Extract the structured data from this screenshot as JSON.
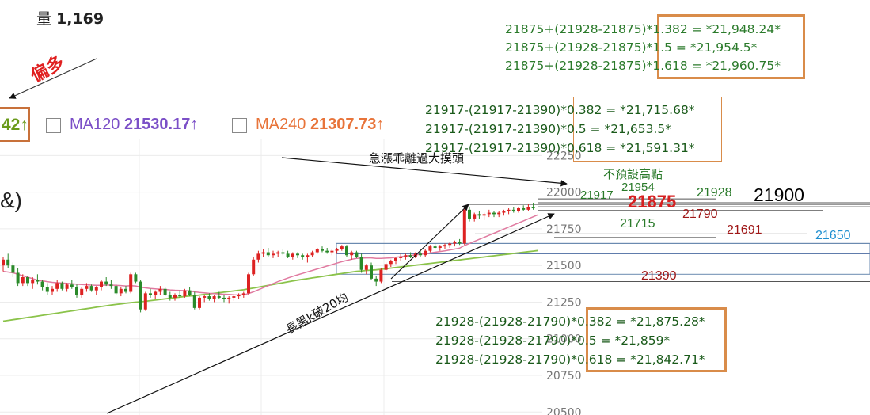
{
  "volume": {
    "label": "量",
    "value": "1,169"
  },
  "annotation_bias": "偏多",
  "ma_header": {
    "partial_value": "42",
    "partial_arrow": "↑",
    "ma120": {
      "label": "MA120",
      "value": "21530.17",
      "arrow": "↑",
      "color": "#7b4fc7"
    },
    "ma240": {
      "label": "MA240",
      "value": "21307.73",
      "arrow": "↑",
      "color": "#e8743a"
    }
  },
  "fib_extension": {
    "color": "#2a7a2a",
    "lines": [
      "21875+(21928-21875)*1.382 = *21,948.24*",
      "21875+(21928-21875)*1.5 = *21,954.5*",
      "21875+(21928-21875)*1.618 = *21,960.75*"
    ]
  },
  "fib_retrace_high": {
    "color": "#1a5a1a",
    "lines": [
      "21917-(21917-21390)*0.382 = *21,715.68*",
      "21917-(21917-21390)*0.5 = *21,653.5*",
      "21917-(21917-21390)*0.618 = *21,591.31*"
    ]
  },
  "fib_retrace_low": {
    "color": "#1a5a1a",
    "lines": [
      "21928-(21928-21790)*0.382 = *21,875.28*",
      "21928-(21928-21790)*0.5 = *21,859*",
      "21928-(21928-21790)*0.618 = *21,842.71*"
    ]
  },
  "annotations": {
    "overheat": "急漲乖離過大摸頭",
    "no_preset_high": "不預設高點",
    "long_black": "長黑k破20均",
    "paren": "&)"
  },
  "level_labels": [
    {
      "text": "21954",
      "value": 21954,
      "color": "#2a7a2a"
    },
    {
      "text": "21917",
      "value": 21917,
      "color": "#2a7a2a"
    },
    {
      "text": "21875",
      "value": 21875,
      "color": "#d62020"
    },
    {
      "text": "21928",
      "value": 21928,
      "color": "#2a7a2a"
    },
    {
      "text": "21900",
      "value": 21900,
      "color": "#000000"
    },
    {
      "text": "21790",
      "value": 21790,
      "color": "#a01818"
    },
    {
      "text": "21715",
      "value": 21715,
      "color": "#2a7a2a"
    },
    {
      "text": "21691",
      "value": 21691,
      "color": "#a01818"
    },
    {
      "text": "21650",
      "value": 21650,
      "color": "#1e8fd0"
    },
    {
      "text": "21390",
      "value": 21390,
      "color": "#a01818"
    }
  ],
  "chart_data": {
    "type": "candlestick",
    "y_ticks": [
      20500,
      20750,
      21000,
      21250,
      21500,
      21750,
      22000,
      22250
    ],
    "y_tick_labels": [
      "20500",
      "20750",
      "21000",
      "21250",
      "21500",
      "21750",
      "22000",
      "22250"
    ],
    "ylim": [
      20480,
      22360
    ],
    "candles": [
      [
        21500,
        21560,
        21460,
        21540
      ],
      [
        21540,
        21580,
        21480,
        21500
      ],
      [
        21500,
        21520,
        21420,
        21450
      ],
      [
        21450,
        21480,
        21360,
        21380
      ],
      [
        21380,
        21440,
        21360,
        21420
      ],
      [
        21420,
        21430,
        21360,
        21380
      ],
      [
        21380,
        21420,
        21340,
        21400
      ],
      [
        21400,
        21440,
        21370,
        21390
      ],
      [
        21390,
        21400,
        21330,
        21350
      ],
      [
        21350,
        21380,
        21300,
        21320
      ],
      [
        21320,
        21360,
        21300,
        21340
      ],
      [
        21340,
        21400,
        21320,
        21380
      ],
      [
        21380,
        21390,
        21330,
        21340
      ],
      [
        21340,
        21380,
        21320,
        21370
      ],
      [
        21370,
        21400,
        21340,
        21350
      ],
      [
        21350,
        21370,
        21280,
        21300
      ],
      [
        21300,
        21350,
        21280,
        21340
      ],
      [
        21340,
        21380,
        21320,
        21360
      ],
      [
        21360,
        21370,
        21320,
        21330
      ],
      [
        21330,
        21360,
        21300,
        21350
      ],
      [
        21350,
        21400,
        21330,
        21390
      ],
      [
        21390,
        21420,
        21360,
        21370
      ],
      [
        21370,
        21400,
        21340,
        21360
      ],
      [
        21360,
        21370,
        21300,
        21310
      ],
      [
        21310,
        21350,
        21290,
        21340
      ],
      [
        21340,
        21360,
        21310,
        21320
      ],
      [
        21320,
        21450,
        21310,
        21440
      ],
      [
        21440,
        21450,
        21380,
        21390
      ],
      [
        21390,
        21400,
        21180,
        21200
      ],
      [
        21200,
        21320,
        21190,
        21310
      ],
      [
        21310,
        21340,
        21280,
        21300
      ],
      [
        21300,
        21330,
        21270,
        21320
      ],
      [
        21320,
        21360,
        21300,
        21340
      ],
      [
        21340,
        21350,
        21290,
        21300
      ],
      [
        21300,
        21320,
        21260,
        21280
      ],
      [
        21280,
        21310,
        21260,
        21300
      ],
      [
        21300,
        21330,
        21280,
        21290
      ],
      [
        21290,
        21340,
        21280,
        21330
      ],
      [
        21330,
        21350,
        21290,
        21300
      ],
      [
        21300,
        21320,
        21200,
        21210
      ],
      [
        21210,
        21290,
        21200,
        21280
      ],
      [
        21280,
        21300,
        21250,
        21290
      ],
      [
        21290,
        21310,
        21260,
        21270
      ],
      [
        21270,
        21300,
        21250,
        21290
      ],
      [
        21290,
        21320,
        21270,
        21280
      ],
      [
        21280,
        21300,
        21250,
        21270
      ],
      [
        21270,
        21290,
        21240,
        21280
      ],
      [
        21280,
        21300,
        21260,
        21290
      ],
      [
        21290,
        21310,
        21270,
        21300
      ],
      [
        21300,
        21320,
        21280,
        21310
      ],
      [
        21310,
        21450,
        21300,
        21440
      ],
      [
        21440,
        21560,
        21430,
        21540
      ],
      [
        21540,
        21600,
        21520,
        21580
      ],
      [
        21580,
        21610,
        21560,
        21590
      ],
      [
        21590,
        21620,
        21560,
        21570
      ],
      [
        21570,
        21600,
        21550,
        21580
      ],
      [
        21580,
        21600,
        21560,
        21590
      ],
      [
        21590,
        21610,
        21570,
        21580
      ],
      [
        21580,
        21600,
        21550,
        21560
      ],
      [
        21560,
        21590,
        21540,
        21580
      ],
      [
        21580,
        21590,
        21550,
        21570
      ],
      [
        21570,
        21580,
        21540,
        21560
      ],
      [
        21560,
        21580,
        21520,
        21570
      ],
      [
        21570,
        21600,
        21560,
        21590
      ],
      [
        21590,
        21620,
        21580,
        21610
      ],
      [
        21610,
        21630,
        21590,
        21600
      ],
      [
        21600,
        21620,
        21580,
        21590
      ],
      [
        21590,
        21610,
        21570,
        21600
      ],
      [
        21600,
        21620,
        21580,
        21610
      ],
      [
        21610,
        21640,
        21600,
        21630
      ],
      [
        21630,
        21640,
        21560,
        21570
      ],
      [
        21570,
        21600,
        21540,
        21590
      ],
      [
        21590,
        21600,
        21550,
        21560
      ],
      [
        21560,
        21580,
        21450,
        21470
      ],
      [
        21470,
        21510,
        21440,
        21500
      ],
      [
        21500,
        21520,
        21400,
        21410
      ],
      [
        21410,
        21430,
        21360,
        21390
      ],
      [
        21390,
        21480,
        21380,
        21470
      ],
      [
        21470,
        21520,
        21460,
        21510
      ],
      [
        21510,
        21540,
        21490,
        21530
      ],
      [
        21530,
        21560,
        21510,
        21550
      ],
      [
        21550,
        21580,
        21530,
        21560
      ],
      [
        21560,
        21580,
        21540,
        21570
      ],
      [
        21570,
        21590,
        21550,
        21560
      ],
      [
        21560,
        21590,
        21550,
        21580
      ],
      [
        21580,
        21600,
        21560,
        21570
      ],
      [
        21570,
        21610,
        21560,
        21600
      ],
      [
        21600,
        21640,
        21590,
        21630
      ],
      [
        21630,
        21650,
        21610,
        21620
      ],
      [
        21620,
        21640,
        21600,
        21630
      ],
      [
        21630,
        21650,
        21610,
        21640
      ],
      [
        21640,
        21660,
        21620,
        21650
      ],
      [
        21650,
        21670,
        21630,
        21660
      ],
      [
        21660,
        21680,
        21640,
        21650
      ],
      [
        21650,
        21900,
        21640,
        21880
      ],
      [
        21880,
        21900,
        21800,
        21820
      ],
      [
        21820,
        21860,
        21800,
        21850
      ],
      [
        21850,
        21870,
        21820,
        21840
      ],
      [
        21840,
        21860,
        21810,
        21850
      ],
      [
        21850,
        21880,
        21830,
        21860
      ],
      [
        21860,
        21870,
        21830,
        21850
      ],
      [
        21850,
        21870,
        21830,
        21860
      ],
      [
        21860,
        21880,
        21840,
        21870
      ],
      [
        21870,
        21890,
        21850,
        21880
      ],
      [
        21880,
        21900,
        21860,
        21870
      ],
      [
        21870,
        21900,
        21860,
        21890
      ],
      [
        21890,
        21910,
        21870,
        21880
      ],
      [
        21880,
        21917,
        21870,
        21900
      ],
      [
        21900,
        21928,
        21880,
        21890
      ]
    ],
    "ma20": [
      21460,
      21455,
      21450,
      21440,
      21430,
      21420,
      21410,
      21400,
      21395,
      21390,
      21385,
      21382,
      21380,
      21378,
      21375,
      21372,
      21370,
      21368,
      21366,
      21365,
      21365,
      21366,
      21366,
      21365,
      21363,
      21360,
      21362,
      21360,
      21352,
      21347,
      21343,
      21340,
      21338,
      21336,
      21333,
      21331,
      21330,
      21328,
      21326,
      21320,
      21316,
      21313,
      21310,
      21308,
      21306,
      21304,
      21302,
      21300,
      21299,
      21300,
      21308,
      21320,
      21334,
      21348,
      21362,
      21376,
      21390,
      21402,
      21414,
      21426,
      21436,
      21446,
      21456,
      21466,
      21476,
      21486,
      21496,
      21506,
      21516,
      21526,
      21534,
      21542,
      21548,
      21550,
      21552,
      21552,
      21548,
      21548,
      21550,
      21552,
      21556,
      21560,
      21564,
      21568,
      21572,
      21576,
      21580,
      21585,
      21590,
      21595,
      21600,
      21606,
      21612,
      21618,
      21636,
      21650,
      21664,
      21678,
      21692,
      21706,
      21720,
      21734,
      21748,
      21762,
      21776,
      21790,
      21804,
      21818,
      21832,
      21846
    ],
    "ma60": [
      21120,
      21125,
      21130,
      21135,
      21140,
      21145,
      21150,
      21155,
      21160,
      21165,
      21170,
      21175,
      21180,
      21185,
      21190,
      21195,
      21200,
      21205,
      21210,
      21215,
      21220,
      21225,
      21230,
      21234,
      21238,
      21242,
      21246,
      21250,
      21252,
      21256,
      21260,
      21264,
      21268,
      21272,
      21276,
      21280,
      21284,
      21288,
      21292,
      21294,
      21298,
      21302,
      21306,
      21310,
      21314,
      21318,
      21322,
      21326,
      21330,
      21334,
      21340,
      21346,
      21352,
      21358,
      21364,
      21370,
      21376,
      21382,
      21388,
      21394,
      21400,
      21405,
      21410,
      21415,
      21420,
      21425,
      21430,
      21435,
      21440,
      21445,
      21450,
      21455,
      21460,
      21462,
      21466,
      21468,
      21470,
      21474,
      21478,
      21482,
      21486,
      21490,
      21494,
      21498,
      21502,
      21506,
      21510,
      21514,
      21518,
      21522,
      21526,
      21530,
      21534,
      21538,
      21542,
      21546,
      21550,
      21554,
      21558,
      21562,
      21566,
      21570,
      21574,
      21578,
      21582,
      21586,
      21590,
      21594,
      21598,
      21602
    ]
  }
}
